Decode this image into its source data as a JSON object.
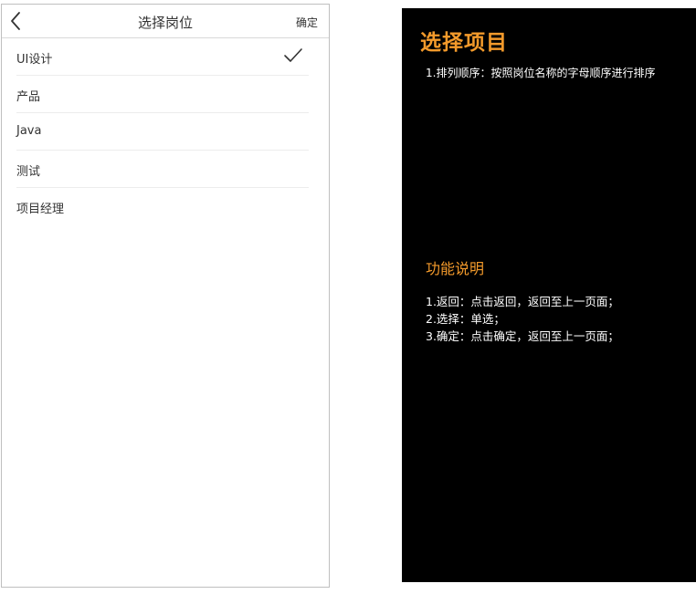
{
  "phone": {
    "header": {
      "title": "选择岗位",
      "confirm_label": "确定",
      "back_icon": "chevron-left-icon"
    },
    "jobs": [
      {
        "label": "UI设计",
        "selected": true
      },
      {
        "label": "产品",
        "selected": false
      },
      {
        "label": "Java",
        "selected": false
      },
      {
        "label": "测试",
        "selected": false
      },
      {
        "label": "项目经理",
        "selected": false
      }
    ],
    "check_icon": "checkmark-icon"
  },
  "notes": {
    "title": "选择项目",
    "sort_rule": "1.排列顺序：按照岗位名称的字母顺序进行排序",
    "function_title": "功能说明",
    "functions": [
      "1.返回：点击返回，返回至上一页面；",
      "2.选择：单选；",
      "3.确定：点击确定，返回至上一页面；"
    ]
  },
  "colors": {
    "accent": "#f39a2b",
    "panel_bg": "#000000",
    "text_dark": "#333333",
    "divider": "#ececec"
  }
}
